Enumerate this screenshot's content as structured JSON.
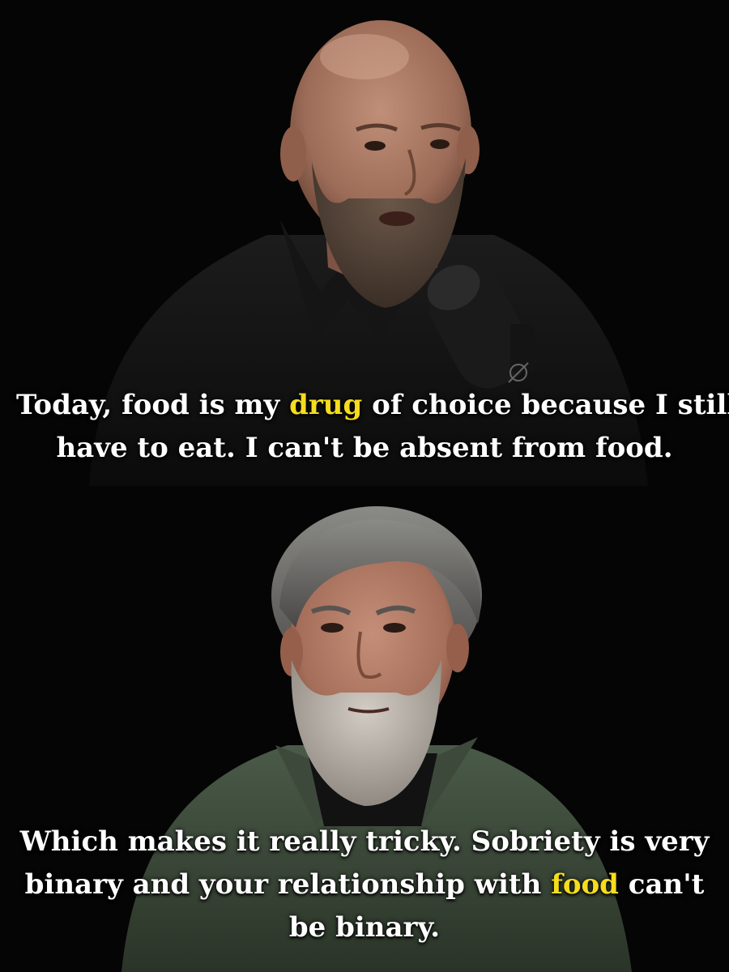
{
  "colors": {
    "background": "#000000",
    "caption_text": "#ffffff",
    "highlight": "#f5dc1e"
  },
  "panels": [
    {
      "caption_lines": [
        [
          {
            "text": "Today, food is my ",
            "highlight": false
          },
          {
            "text": "drug",
            "highlight": true
          },
          {
            "text": " of choice because I still",
            "highlight": false
          }
        ],
        [
          {
            "text": "have to eat. I can't be absent from food.",
            "highlight": false
          }
        ]
      ]
    },
    {
      "caption_lines": [
        [
          {
            "text": "Which makes it really tricky. Sobriety is very",
            "highlight": false
          }
        ],
        [
          {
            "text": "binary and your relationship with ",
            "highlight": false
          },
          {
            "text": "food",
            "highlight": true
          },
          {
            "text": " can't",
            "highlight": false
          }
        ],
        [
          {
            "text": "be binary.",
            "highlight": false
          }
        ]
      ]
    }
  ]
}
